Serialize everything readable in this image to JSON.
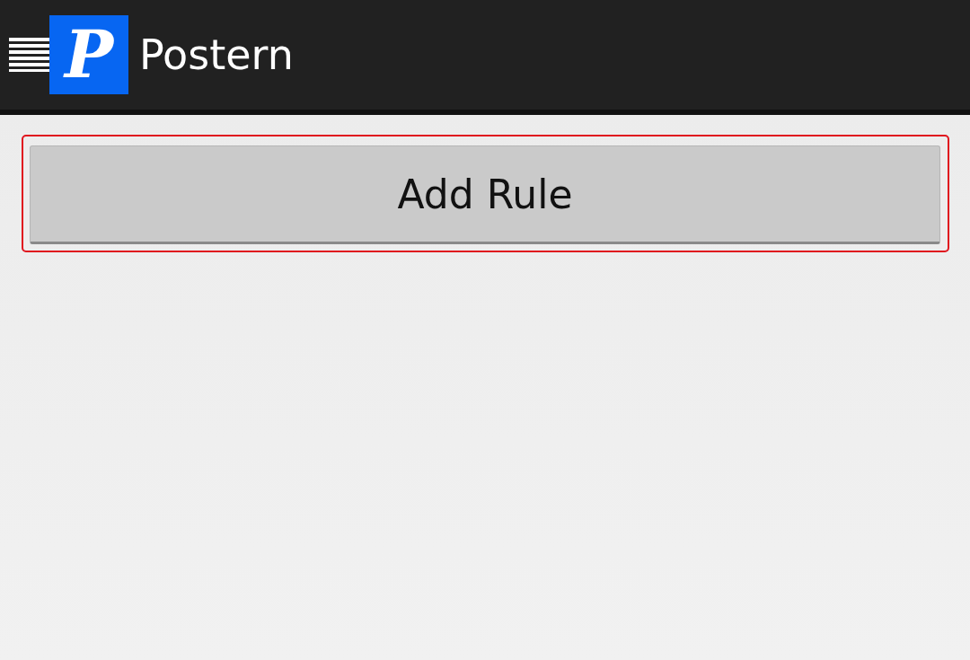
{
  "app_bar": {
    "title": "Postern",
    "logo_letter": "P"
  },
  "add_button": {
    "label": "Add Rule",
    "focused": true
  }
}
